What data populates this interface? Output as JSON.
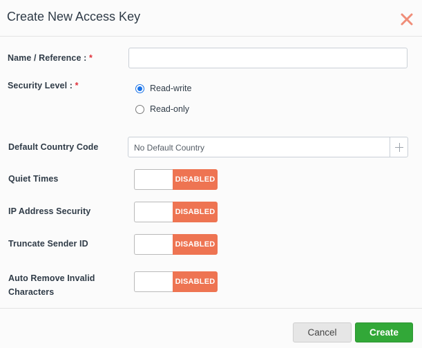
{
  "dialog": {
    "title": "Create New Access Key"
  },
  "form": {
    "name": {
      "label": "Name / Reference :",
      "required_mark": "*",
      "value": "",
      "placeholder": ""
    },
    "security": {
      "label": "Security Level :",
      "required_mark": "*",
      "options": [
        {
          "label": "Read-write",
          "checked": true
        },
        {
          "label": "Read-only",
          "checked": false
        }
      ]
    },
    "country": {
      "label": "Default Country Code",
      "value": "No Default Country"
    },
    "toggles": [
      {
        "label": "Quiet Times",
        "state": "DISABLED"
      },
      {
        "label": "IP Address Security",
        "state": "DISABLED"
      },
      {
        "label": "Truncate Sender ID",
        "state": "DISABLED"
      },
      {
        "label_line1": "Auto Remove Invalid",
        "label_line2": "Characters",
        "state": "DISABLED"
      }
    ]
  },
  "footer": {
    "cancel_label": "Cancel",
    "create_label": "Create"
  },
  "colors": {
    "disabled_badge": "#ee7452",
    "create_button": "#32a838",
    "radio_selected": "#1a73e8",
    "required_mark": "#e0323b",
    "close_icon": "#f08d78"
  }
}
